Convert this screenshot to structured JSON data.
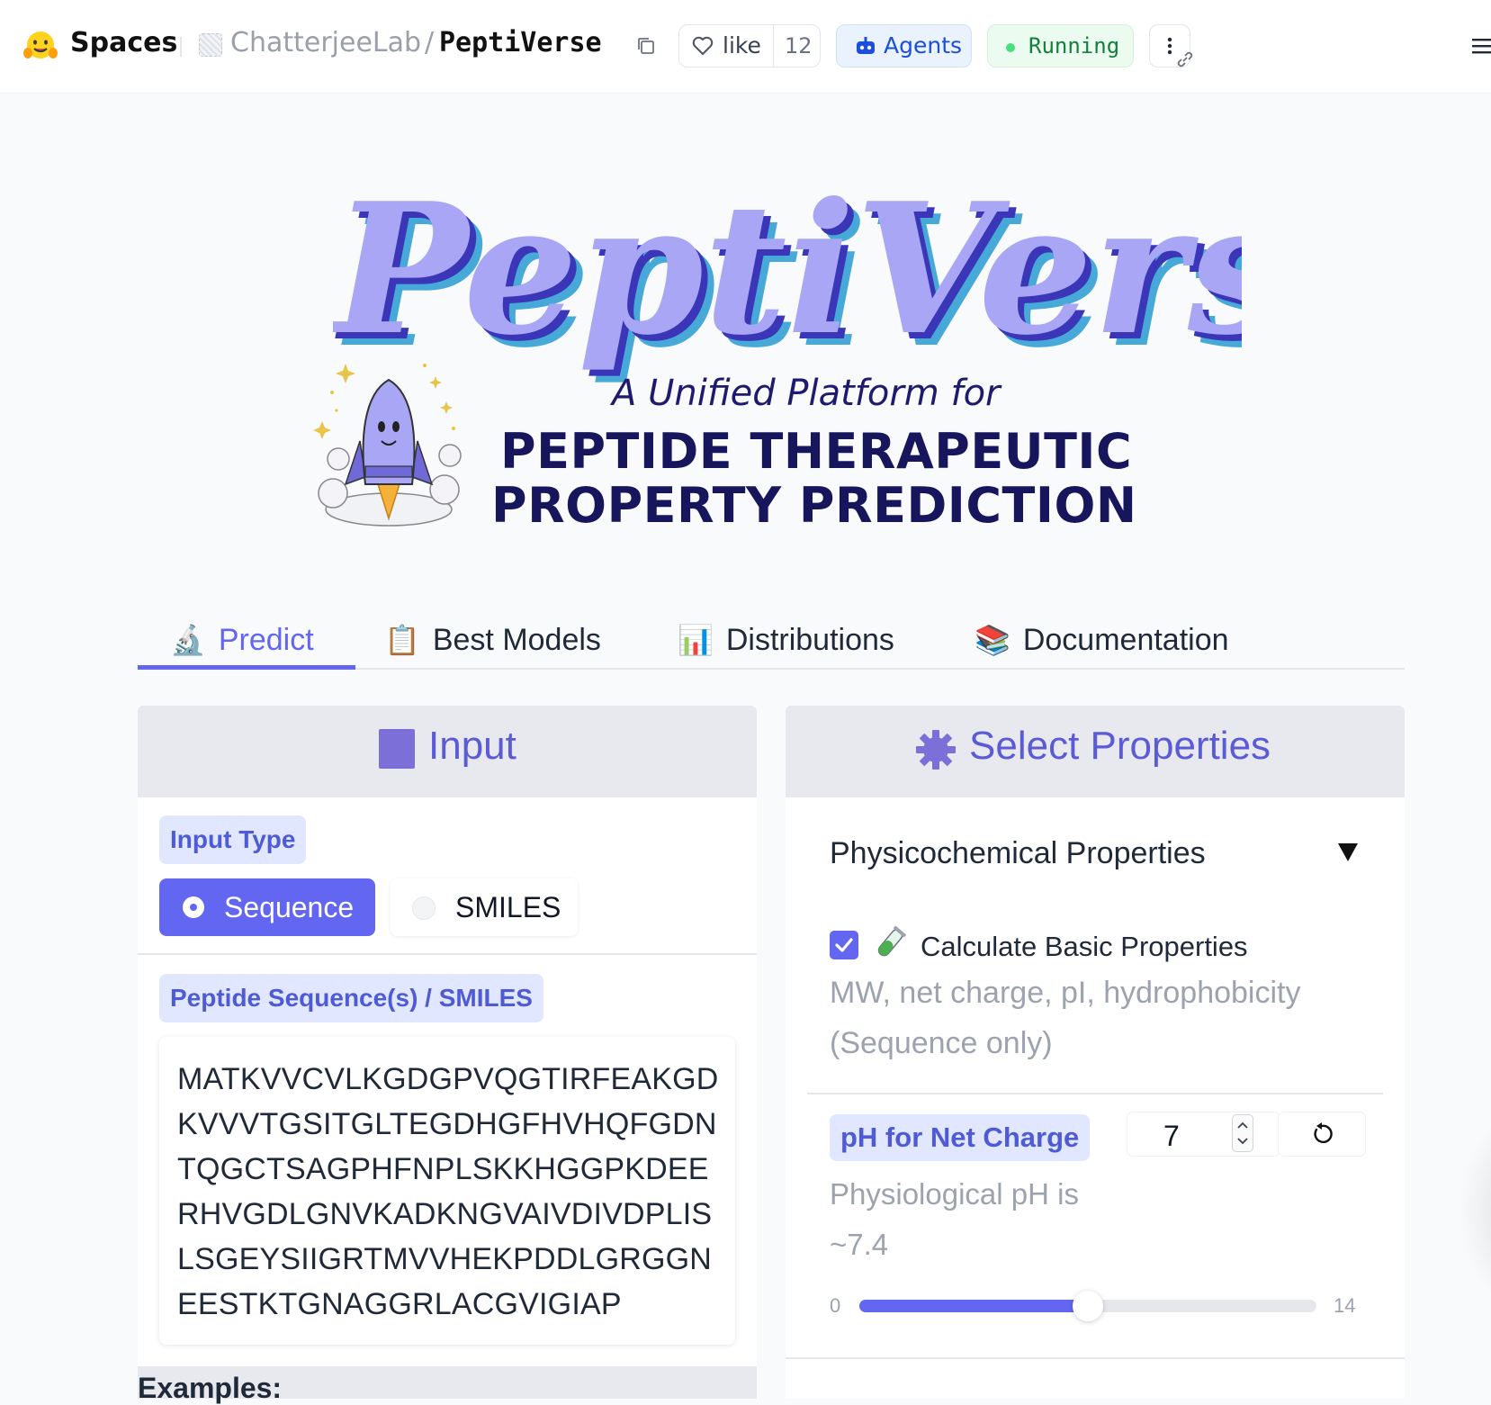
{
  "header": {
    "spaces_label": "Spaces",
    "org_name": "ChatterjeeLab",
    "separator": "/",
    "repo_name": "PeptiVerse",
    "like_label": "like",
    "like_count": "12",
    "agents_label": "Agents",
    "status_label": "Running",
    "colors": {
      "status": "#15803d",
      "agents": "#1d4ed8"
    }
  },
  "hero": {
    "title": "PeptiVerse",
    "subtitle": "A Unified Platform for",
    "line1": "PEPTIDE THERAPEUTIC",
    "line2": "PROPERTY PREDICTION",
    "colors": {
      "title_fill": "#a8a6f5",
      "title_shadow_dark": "#3b35b8",
      "title_shadow_cyan": "#47a9d8",
      "heading": "#17155c"
    }
  },
  "tabs": [
    {
      "icon": "microscope-icon",
      "emoji": "🔬",
      "label": "Predict",
      "active": true
    },
    {
      "icon": "clipboard-icon",
      "emoji": "📋",
      "label": "Best Models",
      "active": false
    },
    {
      "icon": "bar-chart-icon",
      "emoji": "📊",
      "label": "Distributions",
      "active": false
    },
    {
      "icon": "books-icon",
      "emoji": "📚",
      "label": "Documentation",
      "active": false
    }
  ],
  "input_panel": {
    "title": "Input",
    "input_type_label": "Input Type",
    "options": [
      "Sequence",
      "SMILES"
    ],
    "selected": "Sequence",
    "sequence_label": "Peptide Sequence(s) / SMILES",
    "sequence_lines": [
      "MATKVVCVLKGDGPVQGTIRFEAKGD",
      "KVVVTGSITGLTEGDHGFHVHQFGDN",
      "TQGCTSAGPHFNPLSKKHGGPKDEE",
      "RHVGDLGNVKADKNGVAIVDIVDPLIS",
      "LSGEYSIIGRTMVVHEKPDDLGRGGN",
      "EESTKTGNAGGRLACGVIGIAP"
    ],
    "examples_label": "Examples:"
  },
  "properties_panel": {
    "title": "Select Properties",
    "accordion_title": "Physicochemical Properties",
    "basic_checkbox_label": "Calculate Basic Properties",
    "basic_checked": true,
    "basic_info": "MW, net charge, pI, hydrophobicity (Sequence only)",
    "ph_label": "pH for Net Charge",
    "ph_value": "7",
    "ph_info": "Physiological pH is ~7.4",
    "ph_min": "0",
    "ph_max": "14",
    "ph_fraction": 0.5
  },
  "accent_color": "#6366f1"
}
